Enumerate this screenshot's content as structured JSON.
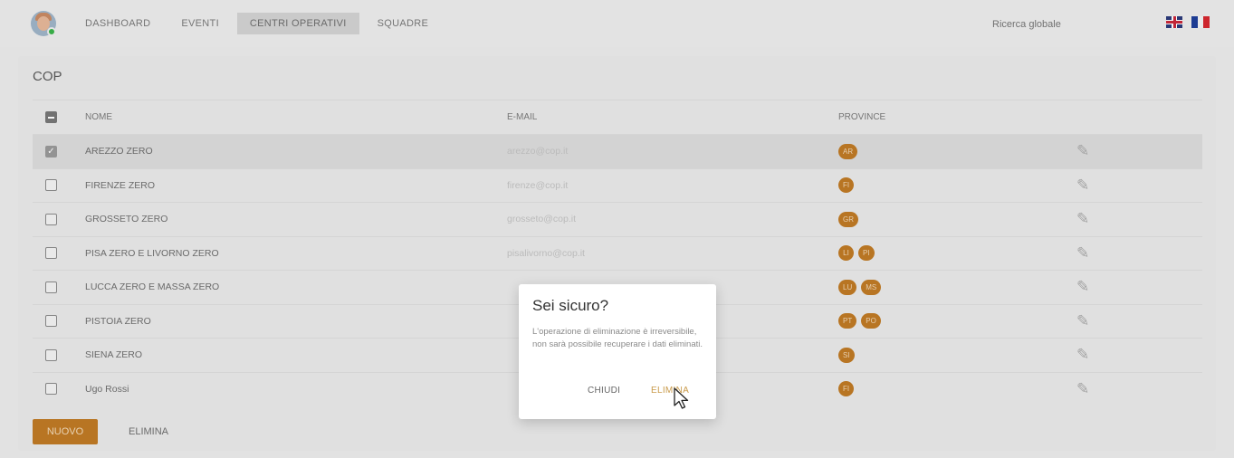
{
  "nav": {
    "items": [
      "DASHBOARD",
      "EVENTI",
      "CENTRI OPERATIVI",
      "SQUADRE"
    ],
    "active": "CENTRI OPERATIVI",
    "search_placeholder": "Ricerca globale",
    "languages": [
      "uk-flag-icon",
      "fr-flag-icon"
    ]
  },
  "card": {
    "title": "COP",
    "columns": [
      "NOME",
      "E-MAIL",
      "PROVINCE"
    ],
    "rows": [
      {
        "name": "AREZZO ZERO",
        "email": "arezzo@cop.it",
        "provinces": [
          "AR"
        ],
        "checked": true
      },
      {
        "name": "FIRENZE ZERO",
        "email": "firenze@cop.it",
        "provinces": [
          "FI"
        ],
        "checked": false
      },
      {
        "name": "GROSSETO ZERO",
        "email": "grosseto@cop.it",
        "provinces": [
          "GR"
        ],
        "checked": false
      },
      {
        "name": "PISA ZERO E LIVORNO ZERO",
        "email": "pisalivorno@cop.it",
        "provinces": [
          "LI",
          "PI"
        ],
        "checked": false
      },
      {
        "name": "LUCCA ZERO E MASSA ZERO",
        "email": "",
        "provinces": [
          "LU",
          "MS"
        ],
        "checked": false
      },
      {
        "name": "PISTOIA ZERO",
        "email": "",
        "provinces": [
          "PT",
          "PO"
        ],
        "checked": false
      },
      {
        "name": "SIENA ZERO",
        "email": "",
        "provinces": [
          "SI"
        ],
        "checked": false
      },
      {
        "name": "Ugo Rossi",
        "email": "",
        "provinces": [
          "FI"
        ],
        "checked": false
      }
    ],
    "new_button": "NUOVO",
    "delete_button": "ELIMINA"
  },
  "dialog": {
    "title": "Sei sicuro?",
    "text": "L'operazione di eliminazione è irreversibile, non sarà possibile recuperare i dati eliminati.",
    "close_label": "CHIUDI",
    "confirm_label": "ELIMINA"
  },
  "colors": {
    "accent": "#c07a25",
    "selected_row": "#dcdcdc"
  }
}
